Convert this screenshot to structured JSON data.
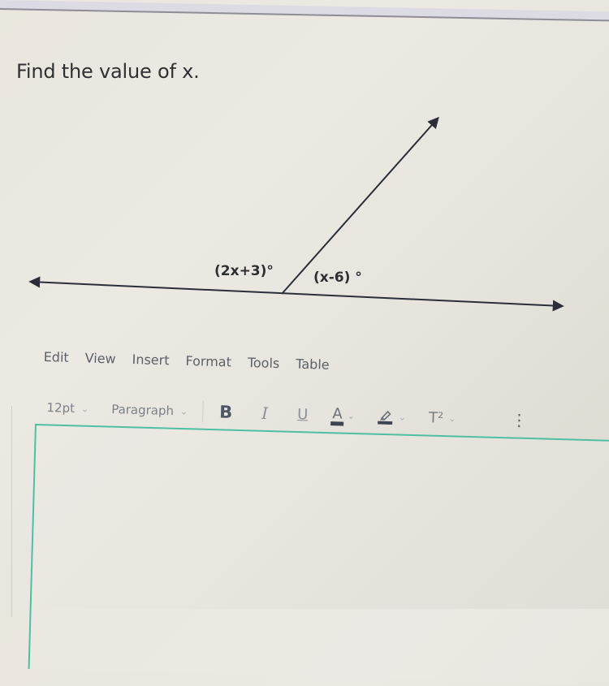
{
  "question": {
    "prompt": "Find the value of x."
  },
  "diagram": {
    "type": "linear-pair-angles",
    "description": "A straight line with arrows at both ends and a ray from a point on the line, forming two adjacent angles",
    "angles": [
      {
        "label": "(2x+3)°",
        "position": "left"
      },
      {
        "label": "(x-6) °",
        "position": "right"
      }
    ],
    "line_color": "#2b2d3a"
  },
  "editor": {
    "menu": [
      "Edit",
      "View",
      "Insert",
      "Format",
      "Tools",
      "Table"
    ],
    "toolbar": {
      "font_size": "12pt",
      "block_format": "Paragraph",
      "bold_label": "B",
      "italic_label": "I",
      "underline_label": "U",
      "text_color_label": "A",
      "superscript_label": "T²",
      "more_label": "⋮",
      "chevron": "⌄"
    },
    "content": "",
    "focus_color": "#4fbfa3"
  }
}
